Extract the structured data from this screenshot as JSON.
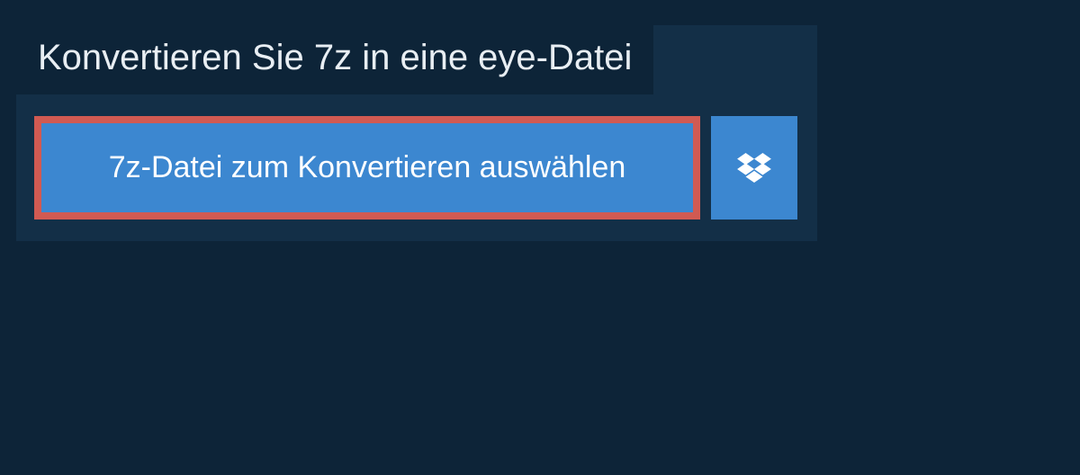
{
  "heading": "Konvertieren Sie 7z in eine eye-Datei",
  "select_button_label": "7z-Datei zum Konvertieren auswählen",
  "colors": {
    "page_bg": "#0d2438",
    "panel_bg": "#132f47",
    "button_bg": "#3c87d0",
    "highlight_border": "#d15a52",
    "text_light": "#e8eef3",
    "text_white": "#ffffff"
  },
  "icons": {
    "dropbox": "dropbox-icon"
  }
}
